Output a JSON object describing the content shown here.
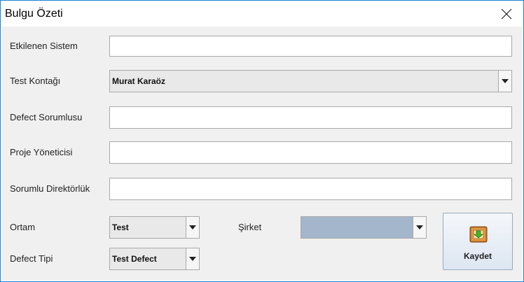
{
  "window": {
    "title": "Bulgu Özeti",
    "close_icon": "close-icon"
  },
  "form": {
    "etkilenen_sistem": {
      "label": "Etkilenen Sistem",
      "value": ""
    },
    "test_kontagi": {
      "label": "Test Kontağı",
      "value": "Murat Karaöz"
    },
    "defect_sorumlusu": {
      "label": "Defect Sorumlusu",
      "value": ""
    },
    "proje_yoneticisi": {
      "label": "Proje Yöneticisi",
      "value": ""
    },
    "sorumlu_direktorluk": {
      "label": "Sorumlu Direktörlük",
      "value": ""
    },
    "ortam": {
      "label": "Ortam",
      "value": "Test"
    },
    "sirket": {
      "label": "Şirket",
      "value": ""
    },
    "defect_tipi": {
      "label": "Defect Tipi",
      "value": "Test Defect"
    }
  },
  "save_button": {
    "label": "Kaydet",
    "icon": "save-box-icon"
  },
  "colors": {
    "accent_border": "#1883d7",
    "panel_bg": "#f0f0f0",
    "disabled_combo": "#a3b6cb"
  }
}
